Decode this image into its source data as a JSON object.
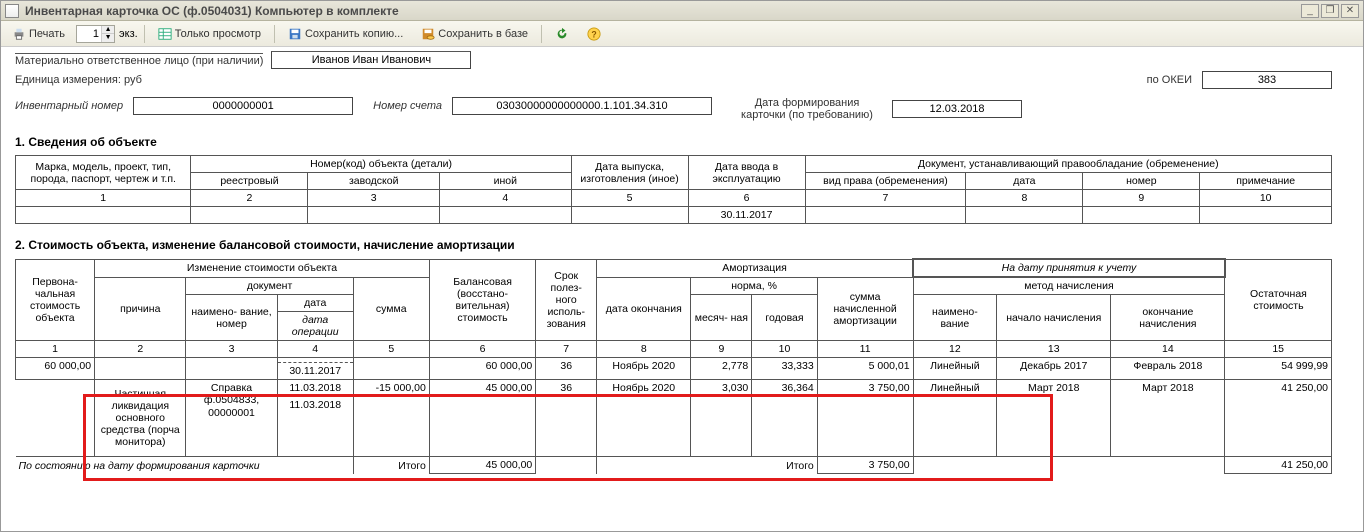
{
  "window": {
    "title": "Инвентарная карточка ОС (ф.0504031) Компьютер в комплекте"
  },
  "toolbar": {
    "print": "Печать",
    "copies": "1",
    "copies_suffix": "экз.",
    "view_only": "Только просмотр",
    "save_copy": "Сохранить копию...",
    "save_db": "Сохранить в базе"
  },
  "header": {
    "resp_label": "Материально ответственное лицо (при наличии)",
    "resp_value": "Иванов Иван Иванович",
    "unit_label": "Единица измерения: руб",
    "okei_label": "по ОКЕИ",
    "okei_value": "383",
    "inv_label": "Инвентарный номер",
    "inv_value": "0000000001",
    "acct_label": "Номер счета",
    "acct_value": "03030000000000000.1.101.34.310",
    "formdate_label": "Дата формирования карточки (по требованию)",
    "formdate_value": "12.03.2018"
  },
  "sec1": {
    "title": "1. Сведения об объекте",
    "h": {
      "c1": "Марка, модель, проект, тип, порода, паспорт, чертеж и т.п.",
      "c2": "Номер(код) объекта (детали)",
      "c2a": "реестровый",
      "c2b": "заводской",
      "c2c": "иной",
      "c5": "Дата выпуска, изготовления (иное)",
      "c6": "Дата ввода в эксплуатацию",
      "c7": "Документ, устанавливающий правообладание (обременение)",
      "c7a": "вид права (обременения)",
      "c7b": "дата",
      "c7c": "номер",
      "c7d": "примечание"
    },
    "nums": {
      "n1": "1",
      "n2": "2",
      "n3": "3",
      "n4": "4",
      "n5": "5",
      "n6": "6",
      "n7": "7",
      "n8": "8",
      "n9": "9",
      "n10": "10"
    },
    "row": {
      "c6": "30.11.2017"
    }
  },
  "sec2": {
    "title": "2. Стоимость объекта, изменение балансовой стоимости, начисление амортизации",
    "h": {
      "c1": "Первона- чальная стоимость объекта",
      "g_change": "Изменение стоимости объекта",
      "c2": "причина",
      "g_doc": "документ",
      "c3": "наимено- вание, номер",
      "c4": "дата",
      "c4i": "дата операции",
      "c5": "сумма",
      "c6": "Балансовая (восстано- вительная) стоимость",
      "c7": "Срок полез- ного исполь- зования",
      "g_amort": "Амортизация",
      "g_date_note": "На дату принятия к учету",
      "c8": "дата окончания",
      "g_norm": "норма, %",
      "c9": "месяч- ная",
      "c10": "годовая",
      "c11": "сумма начисленной амортизации",
      "g_method": "метод начисления",
      "c12": "наимено- вание",
      "c13": "начало начисления",
      "c14": "окончание начисления",
      "c15": "Остаточная стоимость"
    },
    "nums": {
      "n1": "1",
      "n2": "2",
      "n3": "3",
      "n4": "4",
      "n5": "5",
      "n6": "6",
      "n7": "7",
      "n8": "8",
      "n9": "9",
      "n10": "10",
      "n11": "11",
      "n12": "12",
      "n13": "13",
      "n14": "14",
      "n15": "15"
    },
    "r1": {
      "c1": "60 000,00",
      "c4b": "30.11.2017",
      "c6": "60 000,00",
      "c7": "36",
      "c8": "Ноябрь 2020",
      "c9": "2,778",
      "c10": "33,333",
      "c11": "5 000,01",
      "c12": "Линейный",
      "c13": "Декабрь 2017",
      "c14": "Февраль 2018",
      "c15": "54 999,99"
    },
    "r2": {
      "c2": "Частичная ликвидация основного средства (порча монитора)",
      "c3": "Справка ф.0504833, 00000001",
      "c4": "11.03.2018",
      "c4b": "11.03.2018",
      "c5": "-15 000,00",
      "c6": "45 000,00",
      "c7": "36",
      "c8": "Ноябрь 2020",
      "c9": "3,030",
      "c10": "36,364",
      "c11": "3 750,00",
      "c12": "Линейный",
      "c13": "Март 2018",
      "c14": "Март 2018",
      "c15": "41 250,00"
    },
    "tot": {
      "label": "По состоянию на дату формирования карточки",
      "itogo": "Итого",
      "c6": "45 000,00",
      "c11": "3 750,00",
      "c15": "41 250,00"
    }
  }
}
